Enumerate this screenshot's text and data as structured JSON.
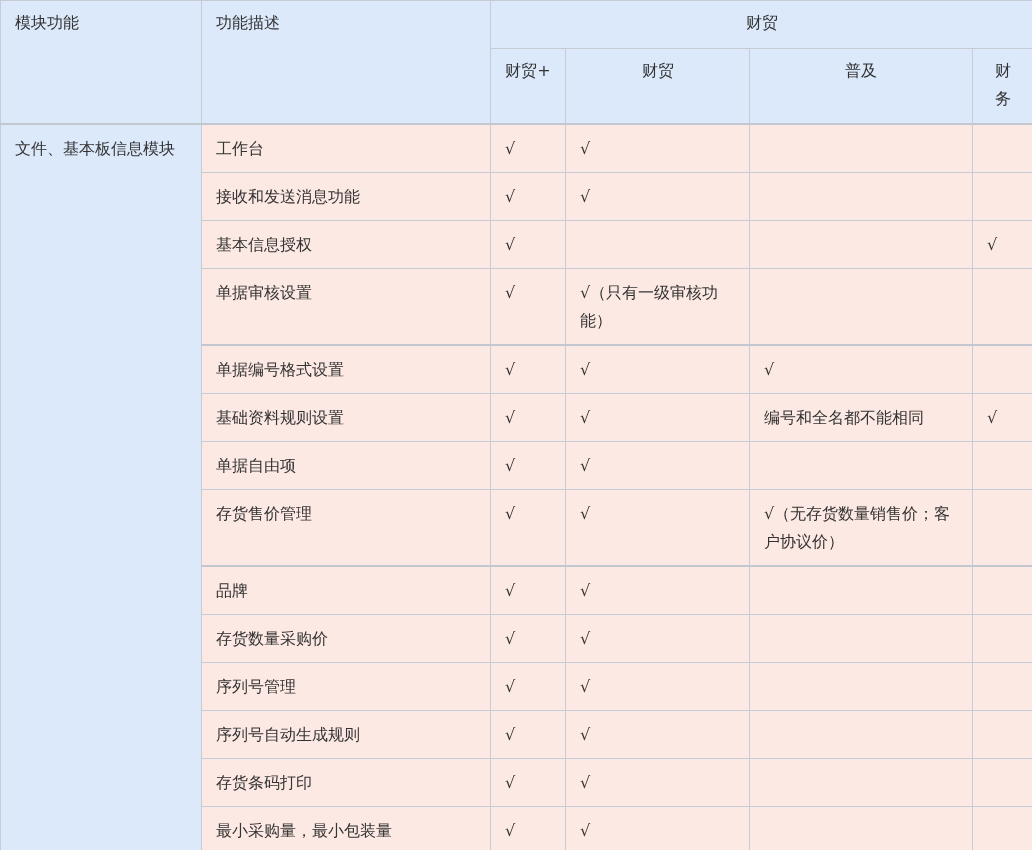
{
  "table": {
    "columns": [
      {
        "label": "模块功能"
      },
      {
        "label": "功能描述"
      }
    ],
    "group_header": "财贸",
    "sub_columns": [
      "财贸+",
      "财贸",
      "普及",
      "财务"
    ],
    "module": "文件、基本板信息模块",
    "sections": [
      [
        {
          "feature": "工作台",
          "cells": [
            "√",
            "√",
            null,
            null
          ]
        },
        {
          "feature": "接收和发送消息功能",
          "cells": [
            "√",
            "√",
            null,
            null
          ]
        },
        {
          "feature": "基本信息授权",
          "cells": [
            "√",
            null,
            null,
            "√"
          ]
        },
        {
          "feature": "单据审核设置",
          "cells": [
            "√",
            "√（只有一级审核功能）",
            null,
            null
          ]
        }
      ],
      [
        {
          "feature": "单据编号格式设置",
          "cells": [
            "√",
            "√",
            "√",
            null
          ]
        },
        {
          "feature": "基础资料规则设置",
          "cells": [
            "√",
            "√",
            "编号和全名都不能相同",
            "√"
          ]
        },
        {
          "feature": "单据自由项",
          "cells": [
            "√",
            "√",
            null,
            null
          ]
        },
        {
          "feature": "存货售价管理",
          "cells": [
            "√",
            "√",
            "√（无存货数量销售价；客户协议价）",
            null
          ]
        }
      ],
      [
        {
          "feature": "品牌",
          "cells": [
            "√",
            "√",
            null,
            null
          ]
        },
        {
          "feature": "存货数量采购价",
          "cells": [
            "√",
            "√",
            null,
            null
          ]
        },
        {
          "feature": "序列号管理",
          "cells": [
            "√",
            "√",
            null,
            null
          ]
        },
        {
          "feature": "序列号自动生成规则",
          "cells": [
            "√",
            "√",
            null,
            null
          ]
        },
        {
          "feature": "存货条码打印",
          "cells": [
            "√",
            "√",
            null,
            null
          ]
        },
        {
          "feature": "最小采购量，最小包装量",
          "cells": [
            "√",
            "√",
            null,
            null
          ]
        }
      ]
    ]
  }
}
